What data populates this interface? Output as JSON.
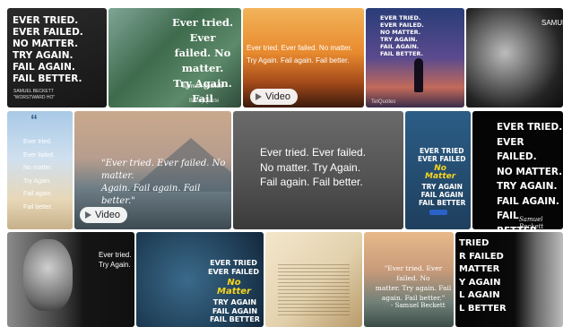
{
  "tiles": {
    "t1": {
      "text": "EVER TRIED.\nEVER FAILED.\nNO MATTER.\nTRY AGAIN.\nFAIL AGAIN.\nFAIL BETTER.",
      "author": "SAMUEL BECKETT\n\"WORSTWARD HO\""
    },
    "t2": {
      "text": "Ever tried. Ever\nfailed. No matter.\nTry Again. Fail\nagain. Fail better",
      "author": "Samuel Beckett",
      "watermark": "BrainyQuote"
    },
    "t3": {
      "text": "Ever tried. Ever failed. No matter.\nTry Again. Fail again. Fail better.",
      "video_label": "Video"
    },
    "t4": {
      "text": "EVER TRIED.\nEVER FAILED.\nNO MATTER.\nTRY AGAIN.\nFAIL AGAIN.\nFAIL BETTER.",
      "watermark": "TetQuotes"
    },
    "t5": {
      "author": "SAMUEL"
    },
    "t6": {
      "lines": [
        "Ever tried.",
        "Ever failed.",
        "No matter.",
        "Try Again.",
        "Fail again.",
        "Fail better."
      ]
    },
    "t7": {
      "text": "\"Ever tried. Ever failed. No matter.\nAgain. Fail again. Fail better.\"",
      "video_label": "Video"
    },
    "t8": {
      "text": "Ever tried. Ever failed.\nNo matter. Try Again.\nFail again. Fail better."
    },
    "t9": {
      "top": "EVER TRIED\nEVER FAILED",
      "mid": "No\nMatter",
      "bottom": "TRY AGAIN\nFAIL AGAIN\nFAIL BETTER"
    },
    "t10": {
      "text": "EVER TRIED.\nEVER FAILED.\nNO MATTER.\nTRY AGAIN.\nFAIL AGAIN.\nFAIL BETTER.",
      "author": "Samuel Beckett"
    },
    "t11": {
      "text": "Ever tried.\nTry Again."
    },
    "t12": {
      "top": "EVER TRIED\nEVER FAILED",
      "mid": "No\nMatter",
      "bottom": "TRY AGAIN\nFAIL AGAIN\nFAIL BETTER"
    },
    "t13": {},
    "t14": {
      "text": "\"Ever tried. Ever failed. No\nmatter. Try again. Fail\nagain. Fail better.\"",
      "author": "- Samuel Beckett"
    },
    "t15": {
      "text": "TRIED\nR FAILED\nMATTER\nY AGAIN\nL AGAIN\nL BETTER"
    }
  },
  "colors": {
    "yellow": "#f7d51d",
    "badge_bg": "#ffffff"
  },
  "icons": {
    "play": "play-icon",
    "quote": "quote-icon"
  }
}
